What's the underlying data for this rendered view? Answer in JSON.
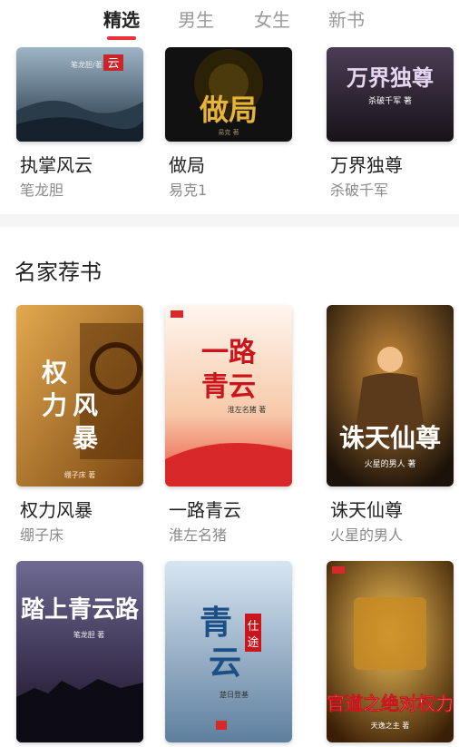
{
  "tabs": [
    {
      "label": "精选",
      "active": true
    },
    {
      "label": "男生",
      "active": false
    },
    {
      "label": "女生",
      "active": false
    },
    {
      "label": "新书",
      "active": false
    }
  ],
  "top_books": [
    {
      "title": "执掌风云",
      "author": "笔龙胆",
      "cover_text": "云",
      "cover_byline": "笔龙胆/著"
    },
    {
      "title": "做局",
      "author": "易克1",
      "cover_text": "做局",
      "cover_byline": "易克 著"
    },
    {
      "title": "万界独尊",
      "author": "杀破千军",
      "cover_text": "万界独尊",
      "cover_byline": "杀破千军 著"
    }
  ],
  "section": {
    "title": "名家荐书"
  },
  "recommended_books": [
    {
      "title": "权力风暴",
      "author": "绷子床",
      "cover_text": "权力风暴",
      "cover_byline": "绷子床 著"
    },
    {
      "title": "一路青云",
      "author": "淮左名猪",
      "cover_text": "一路青云",
      "cover_byline": "淮左名猪 著"
    },
    {
      "title": "诛天仙尊",
      "author": "火星的男人",
      "cover_text": "诛天仙尊",
      "cover_byline": "火星的男人 著"
    }
  ],
  "bottom_books": [
    {
      "cover_text": "踏上青云路",
      "cover_byline": "笔龙胆 著"
    },
    {
      "cover_text": "青云仕途",
      "cover_byline": "楚日登基"
    },
    {
      "cover_text": "官道之绝对权力",
      "cover_byline": "天逸之主 著"
    }
  ],
  "colors": {
    "accent": "#e8313b",
    "tab_inactive": "#9a9a9a",
    "author": "#8a8a8a"
  }
}
